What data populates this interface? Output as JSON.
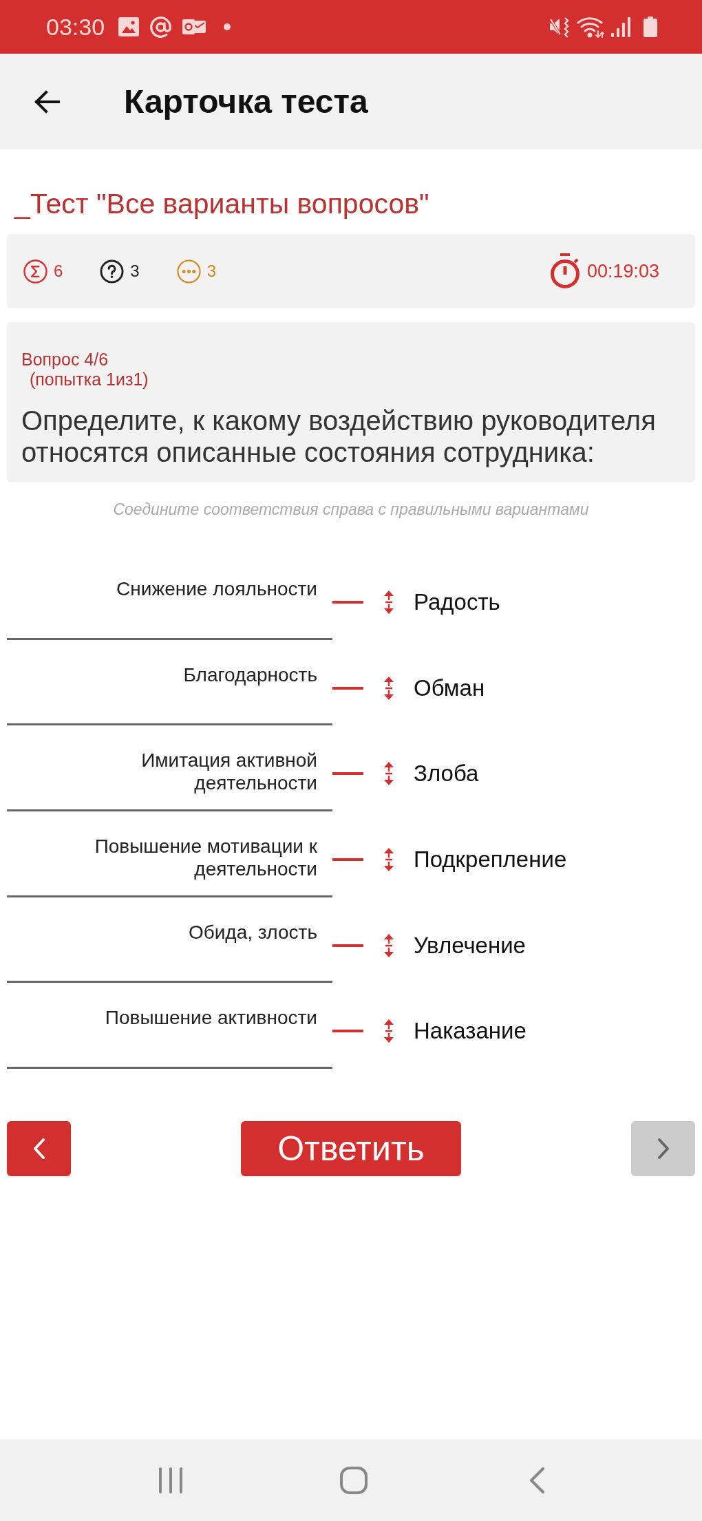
{
  "status_bar": {
    "time": "03:30"
  },
  "app_bar": {
    "title": "Карточка теста"
  },
  "test_title": "_Тест \"Все варианты вопросов\"",
  "stats": {
    "counters": [
      {
        "kind": "total",
        "value": "6",
        "color": "#d32f2f"
      },
      {
        "kind": "questions",
        "value": "3",
        "color": "#222222"
      },
      {
        "kind": "pending",
        "value": "3",
        "color": "#d4861f"
      }
    ],
    "timer": "00:19:03"
  },
  "question": {
    "number": "Вопрос 4/6",
    "attempt": "(попытка 1из1)",
    "text": "Определите, к какому воздействию руководителя относятся описанные состояния сотрудника:"
  },
  "hint": "Соедините соответствия справа с правильными вариантами",
  "pairs": [
    {
      "left": "Снижение лояльности",
      "right": "Радость"
    },
    {
      "left": "Благодарность",
      "right": "Обман"
    },
    {
      "left": "Имитация активной деятельности",
      "right": "Злоба"
    },
    {
      "left": "Повышение мотивации к деятельности",
      "right": "Подкрепление"
    },
    {
      "left": "Обида, злость",
      "right": "Увлечение"
    },
    {
      "left": "Повышение активности",
      "right": "Наказание"
    }
  ],
  "buttons": {
    "previous": {
      "disabled": false
    },
    "answer": {
      "label": "Ответить"
    },
    "next": {
      "disabled": true
    }
  }
}
